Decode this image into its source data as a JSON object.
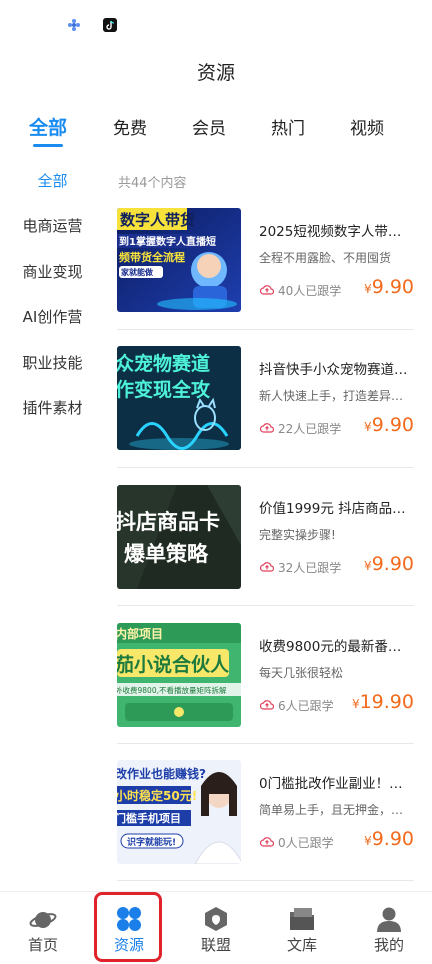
{
  "page_title": "资源",
  "tabs": [
    {
      "label": "全部",
      "active": true
    },
    {
      "label": "免费"
    },
    {
      "label": "会员"
    },
    {
      "label": "热门"
    },
    {
      "label": "视频"
    }
  ],
  "categories": [
    {
      "label": "全部",
      "active": true
    },
    {
      "label": "电商运营"
    },
    {
      "label": "商业变现"
    },
    {
      "label": "AI创作营"
    },
    {
      "label": "职业技能"
    },
    {
      "label": "插件素材"
    }
  ],
  "count_text": "共44个内容",
  "items": [
    {
      "title": "2025短视频数字人带货…",
      "subtitle": "全程不用露脸、不用囤货",
      "followers": "40人已跟学",
      "currency": "¥",
      "price": "9.90",
      "thumb_lines": [
        "数字人带货",
        "到1掌握数字人直播短",
        "频带货全流程",
        "家就能做"
      ]
    },
    {
      "title": "抖音快手小众宠物赛道…",
      "subtitle": "新人快速上手，打造差异…",
      "followers": "22人已跟学",
      "currency": "¥",
      "price": "9.90",
      "thumb_lines": [
        "众宠物赛道",
        "作变现全攻"
      ]
    },
    {
      "title": "价值1999元 抖店商品卡…",
      "subtitle": "完整实操步骤!",
      "followers": "32人已跟学",
      "currency": "¥",
      "price": "9.90",
      "thumb_lines": [
        "抖店商品卡",
        "爆单策略"
      ]
    },
    {
      "title": "收费9800元的最新番茄…",
      "subtitle": "每天几张很轻松",
      "followers": "6人已跟学",
      "currency": "¥",
      "price": "19.90",
      "thumb_lines": [
        "内部项目",
        "茄小说合伙人",
        "外收费9800,不看播放量矩阵拆解"
      ]
    },
    {
      "title": "0门槛批改作业副业！最…",
      "subtitle": "简单易上手，且无押金，…",
      "followers": "0人已跟学",
      "currency": "¥",
      "price": "9.90",
      "thumb_lines": [
        "改作业也能赚钱?",
        "小时稳定50元!",
        "门槛手机项目",
        "识字就能玩!"
      ]
    }
  ],
  "bottom_nav": [
    {
      "label": "首页",
      "icon": "planet-icon"
    },
    {
      "label": "资源",
      "icon": "grid-icon",
      "active": true
    },
    {
      "label": "联盟",
      "icon": "alliance-icon"
    },
    {
      "label": "文库",
      "icon": "folder-icon"
    },
    {
      "label": "我的",
      "icon": "user-icon"
    }
  ],
  "colors": {
    "accent": "#1a8cf0",
    "price": "#f26b1d",
    "highlight": "#e0232b"
  }
}
